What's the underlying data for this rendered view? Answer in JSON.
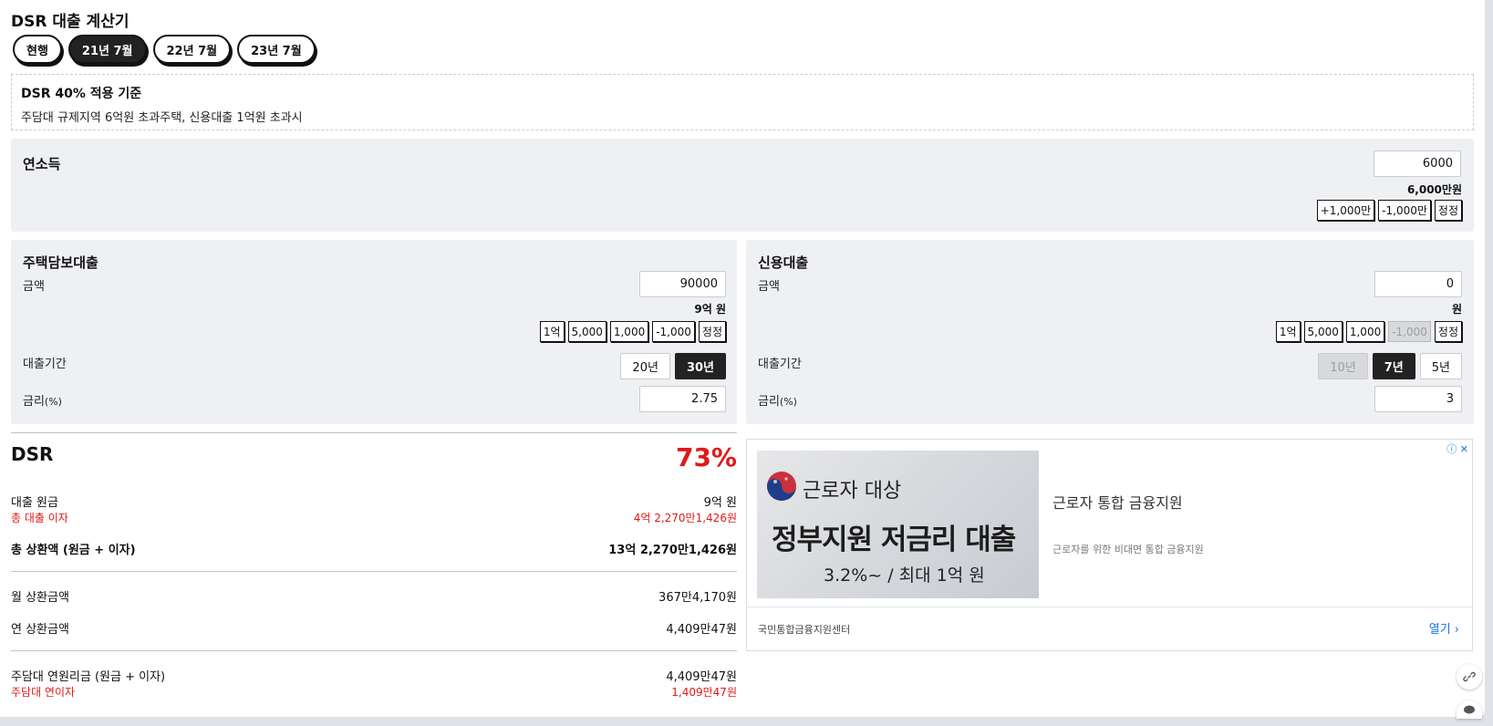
{
  "title": "DSR 대출 계산기",
  "tabs": [
    {
      "label": "현행",
      "active": false
    },
    {
      "label": "21년 7월",
      "active": true
    },
    {
      "label": "22년 7월",
      "active": false
    },
    {
      "label": "23년 7월",
      "active": false
    }
  ],
  "notice": {
    "heading": "DSR 40% 적용 기준",
    "body": "주담대 규제지역 6억원 초과주택, 신용대출 1억원 초과시"
  },
  "income": {
    "label": "연소득",
    "value": "6000",
    "formatted": "6,000만원",
    "buttons": [
      "+1,000만",
      "-1,000만",
      "정정"
    ]
  },
  "mortgage": {
    "title": "주택담보대출",
    "amount_label": "금액",
    "amount_value": "90000",
    "amount_formatted": "9억 원",
    "amount_buttons": [
      "1억",
      "5,000",
      "1,000",
      "-1,000",
      "정정"
    ],
    "period_label": "대출기간",
    "periods": [
      {
        "label": "20년",
        "active": false
      },
      {
        "label": "30년",
        "active": true
      }
    ],
    "rate_label": "금리",
    "rate_unit": "(%)",
    "rate_value": "2.75"
  },
  "credit": {
    "title": "신용대출",
    "amount_label": "금액",
    "amount_value": "0",
    "amount_formatted": "원",
    "amount_buttons": [
      "1억",
      "5,000",
      "1,000",
      "-1,000",
      "정정"
    ],
    "period_label": "대출기간",
    "periods": [
      {
        "label": "10년",
        "disabled": true
      },
      {
        "label": "7년",
        "active": true
      },
      {
        "label": "5년",
        "active": false
      }
    ],
    "rate_label": "금리",
    "rate_unit": "(%)",
    "rate_value": "3"
  },
  "result": {
    "heading": "DSR",
    "percent": "73%",
    "principal_label": "대출 원금",
    "principal_value": "9억 원",
    "interest_label": "총 대출 이자",
    "interest_value": "4억 2,270만1,426원",
    "total_label": "총 상환액 (원금 + 이자)",
    "total_value": "13억 2,270만1,426원",
    "monthly_label": "월 상환금액",
    "monthly_value": "367만4,170원",
    "yearly_label": "연 상환금액",
    "yearly_value": "4,409만47원",
    "mortgage_yearly_label": "주담대 연원리금 (원금 + 이자)",
    "mortgage_yearly_value": "4,409만47원",
    "mortgage_interest_label": "주담대 연이자",
    "mortgage_interest_value": "1,409만47원"
  },
  "ad": {
    "img_line1": "근로자 대상",
    "img_line2": "정부지원 저금리 대출",
    "img_line3": "3.2%~ / 최대 1억 원",
    "title": "근로자 통합 금융지원",
    "desc": "근로자를 위한 비대면 통합 금융지원",
    "source": "국민통합금융지원센터",
    "open": "열기",
    "info": "ⓘ ✕"
  },
  "colors": {
    "accent_red": "#e01919",
    "panel_bg": "#eef0f3",
    "active_dark": "#222222",
    "link_blue": "#1a73e8"
  }
}
